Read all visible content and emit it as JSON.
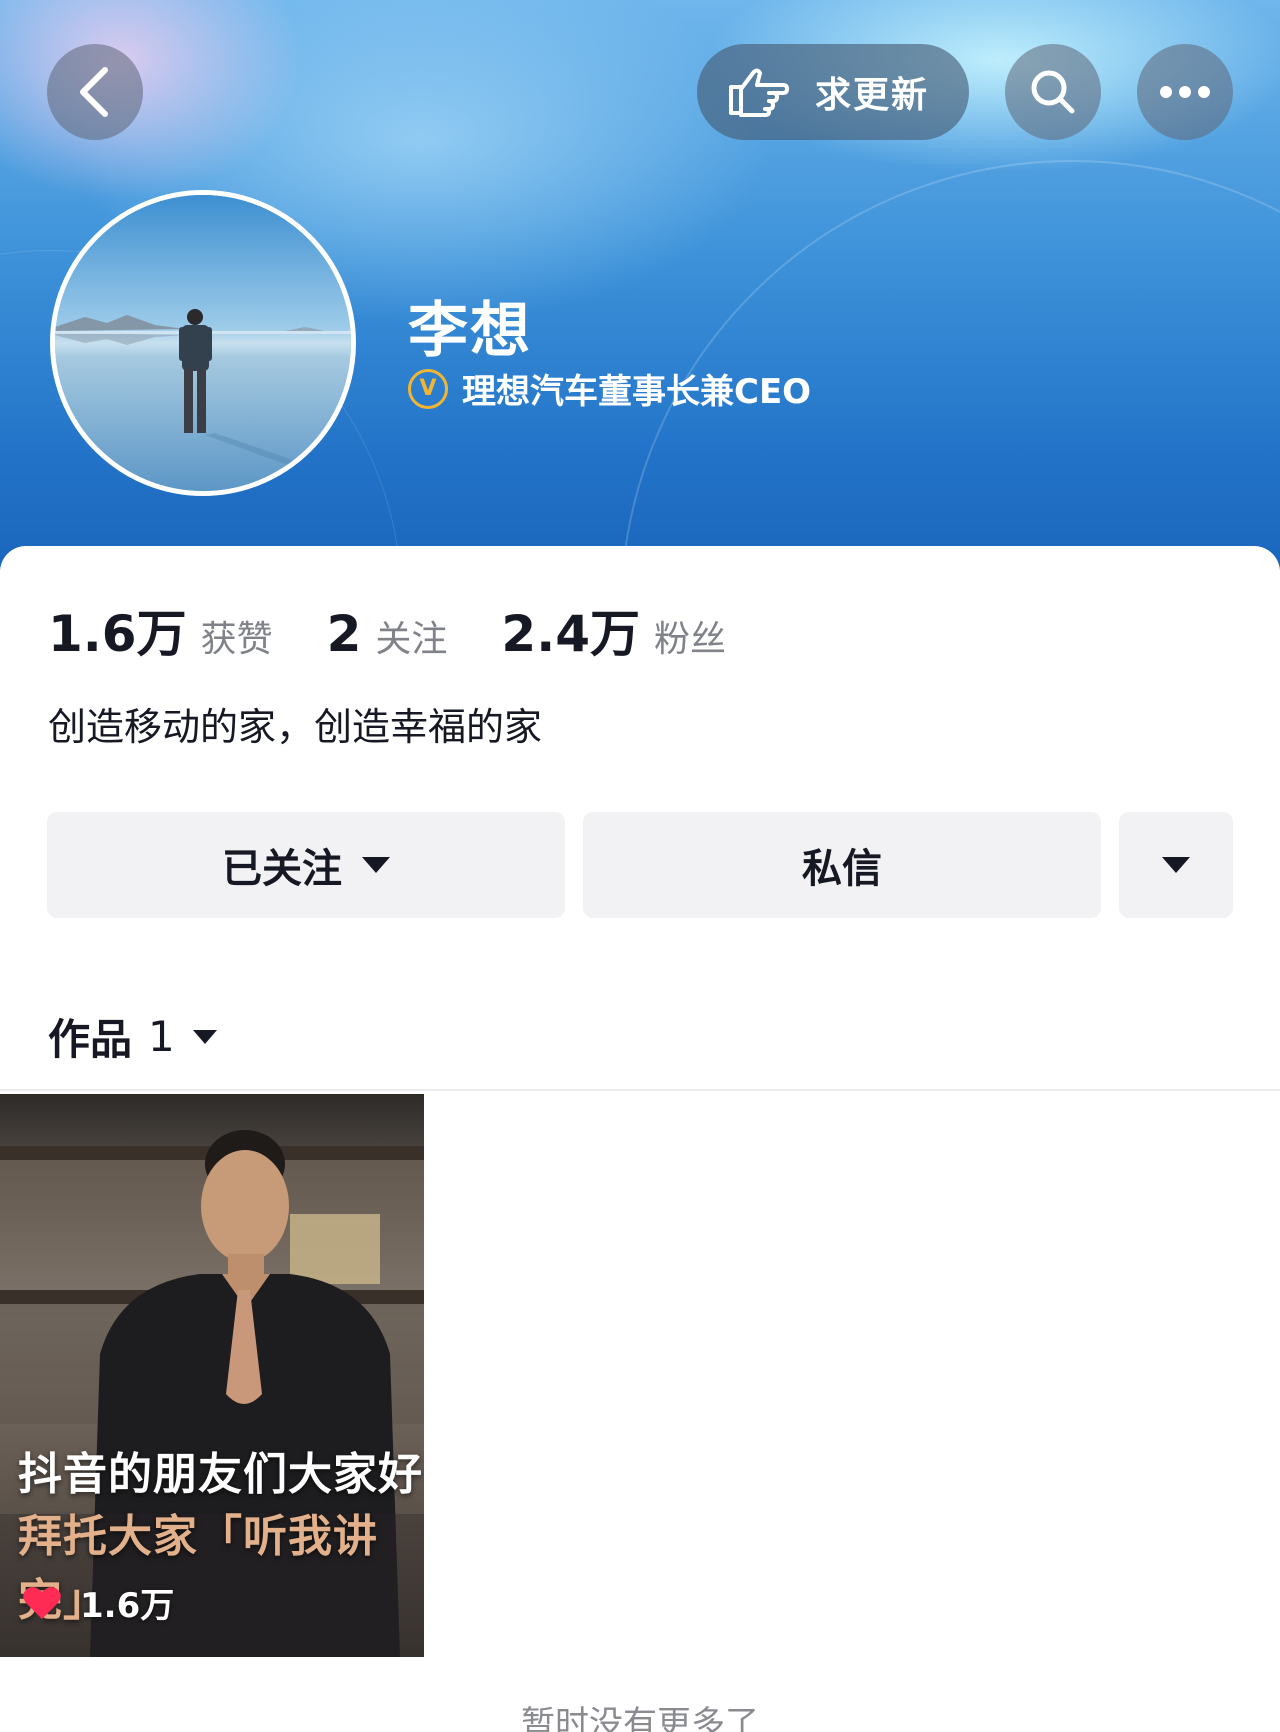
{
  "header": {
    "request_update_label": "求更新",
    "name": "李想",
    "verification": "理想汽车董事长兼CEO",
    "verify_badge": "V"
  },
  "icons": {
    "back": "chevron-left-icon",
    "hand": "pointing-hand-icon",
    "search": "search-icon",
    "more": "more-dots-icon",
    "heart": "heart-icon"
  },
  "stats": [
    {
      "value": "1.6万",
      "label": "获赞"
    },
    {
      "value": "2",
      "label": "关注"
    },
    {
      "value": "2.4万",
      "label": "粉丝"
    }
  ],
  "bio": "创造移动的家，创造幸福的家",
  "actions": {
    "follow_label": "已关注",
    "message_label": "私信"
  },
  "works_tab": {
    "label": "作品",
    "count": "1"
  },
  "videos": [
    {
      "caption_line1": "抖音的朋友们大家好",
      "caption_line2": "拜托大家「听我讲完」",
      "likes": "1.6万"
    }
  ],
  "footer_text": "暂时没有更多了",
  "colors": {
    "accent_verify": "#f2b531",
    "heart": "#fe2c55",
    "button_bg": "#f2f2f4",
    "text_primary": "#161823",
    "text_secondary": "#80828a"
  }
}
